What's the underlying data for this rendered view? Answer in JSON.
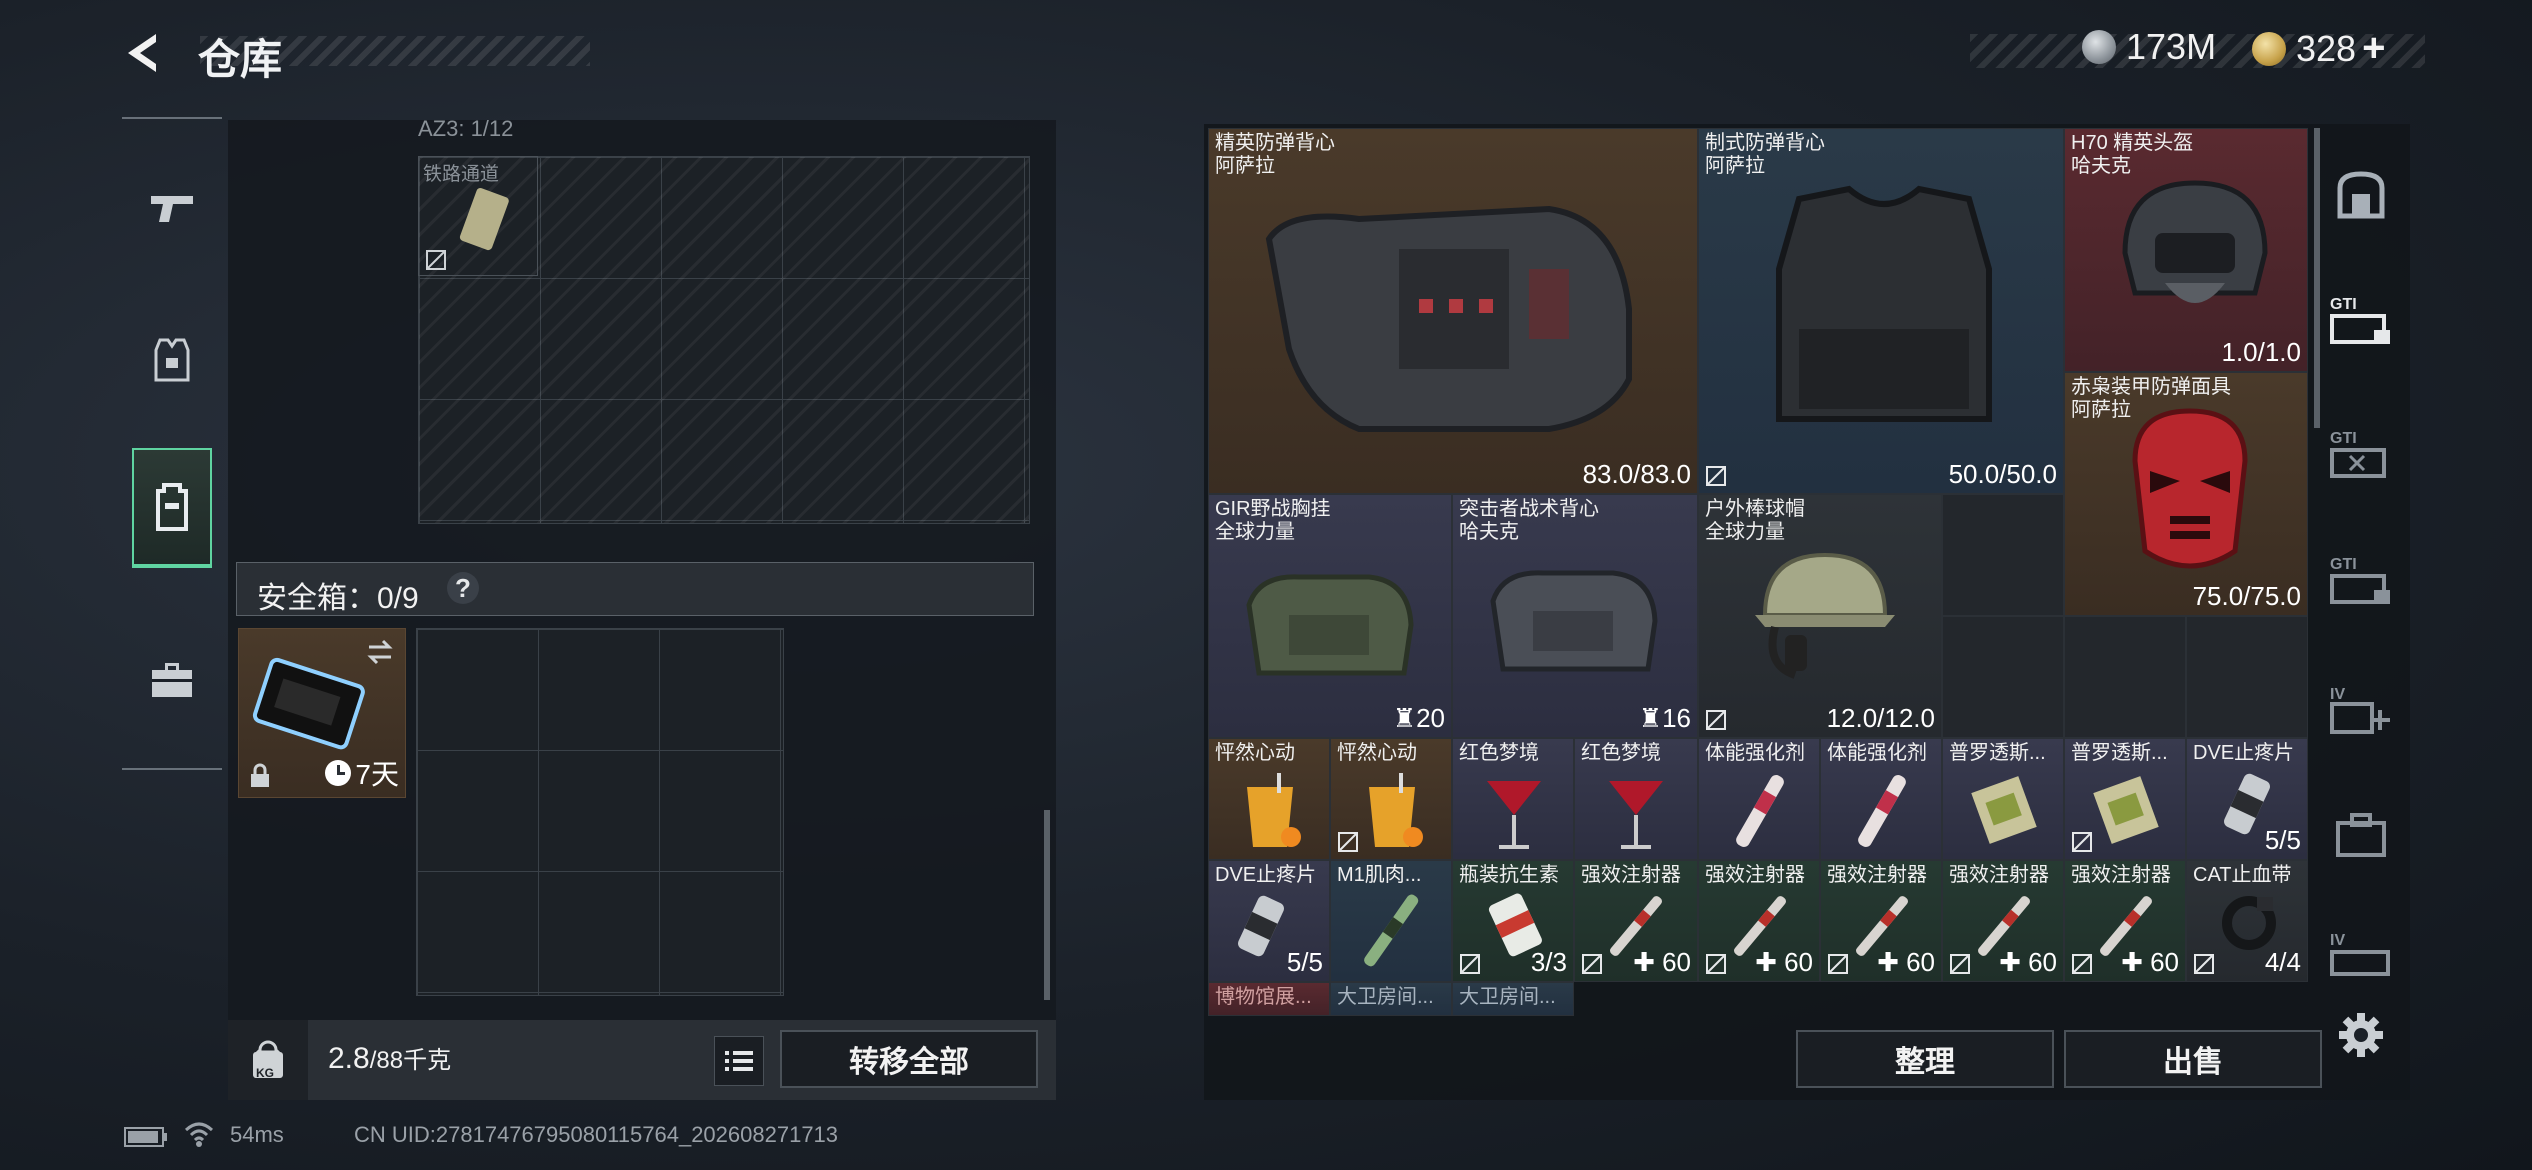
{
  "header": {
    "title": "仓库",
    "currency1": "173M",
    "currency2": "328"
  },
  "left_panel": {
    "container_label": "AZ3: 1/12",
    "container_item_label": "铁路通道",
    "safebox_label": "安全箱：0/9",
    "safebox_help": "?",
    "safebox_item_time": "7天",
    "weight_value": "2.8",
    "weight_total": "/88千克",
    "weight_icon_label": "KG",
    "transfer_all": "转移全部"
  },
  "right_panel": {
    "items": [
      {
        "name": "精英防弹背心",
        "sub": "阿萨拉",
        "value": "83.0/83.0",
        "rarity": "orange"
      },
      {
        "name": "制式防弹背心",
        "sub": "阿萨拉",
        "value": "50.0/50.0",
        "rarity": "blue"
      },
      {
        "name": "H70 精英头盔",
        "sub": "哈夫克",
        "value": "1.0/1.0",
        "rarity": "red"
      },
      {
        "name": "赤枭装甲防弹面具",
        "sub": "阿萨拉",
        "value": "75.0/75.0",
        "rarity": "red"
      },
      {
        "name": "GIR野战胸挂",
        "sub": "全球力量",
        "value": "20",
        "rarity": "purple"
      },
      {
        "name": "突击者战术背心",
        "sub": "哈夫克",
        "value": "16",
        "rarity": "purple"
      },
      {
        "name": "户外棒球帽",
        "sub": "全球力量",
        "value": "12.0/12.0",
        "rarity": "gray"
      },
      {
        "name": "怦然心动",
        "value": "",
        "rarity": "orange"
      },
      {
        "name": "怦然心动",
        "value": "",
        "rarity": "orange"
      },
      {
        "name": "红色梦境",
        "value": "",
        "rarity": "purple"
      },
      {
        "name": "红色梦境",
        "value": "",
        "rarity": "purple"
      },
      {
        "name": "体能强化剂",
        "value": "",
        "rarity": "purple"
      },
      {
        "name": "体能强化剂",
        "value": "",
        "rarity": "purple"
      },
      {
        "name": "普罗透斯...",
        "value": "",
        "rarity": "purple"
      },
      {
        "name": "普罗透斯...",
        "value": "",
        "rarity": "purple"
      },
      {
        "name": "DVE止疼片",
        "value": "5/5",
        "rarity": "purple"
      },
      {
        "name": "DVE止疼片",
        "value": "5/5",
        "rarity": "purple"
      },
      {
        "name": "M1肌肉...",
        "value": "",
        "rarity": "blue"
      },
      {
        "name": "瓶装抗生素",
        "value": "3/3",
        "rarity": "green"
      },
      {
        "name": "强效注射器",
        "value": "60",
        "rarity": "green"
      },
      {
        "name": "强效注射器",
        "value": "60",
        "rarity": "green"
      },
      {
        "name": "强效注射器",
        "value": "60",
        "rarity": "green"
      },
      {
        "name": "强效注射器",
        "value": "60",
        "rarity": "green"
      },
      {
        "name": "强效注射器",
        "value": "60",
        "rarity": "green"
      },
      {
        "name": "CAT止血带",
        "value": "4/4",
        "rarity": "gray"
      },
      {
        "name": "博物馆展...",
        "value": "",
        "rarity": "red"
      },
      {
        "name": "大卫房间...",
        "value": "",
        "rarity": "blue"
      },
      {
        "name": "大卫房间...",
        "value": "",
        "rarity": "blue"
      }
    ],
    "sort_button": "整理",
    "sell_button": "出售"
  },
  "right_rail": {
    "labels": [
      "GTI",
      "GTI",
      "GTI",
      "IV",
      "IV"
    ]
  },
  "footer": {
    "ping": "54ms",
    "uid": "CN UID:27817476795080115764_202608271713"
  }
}
